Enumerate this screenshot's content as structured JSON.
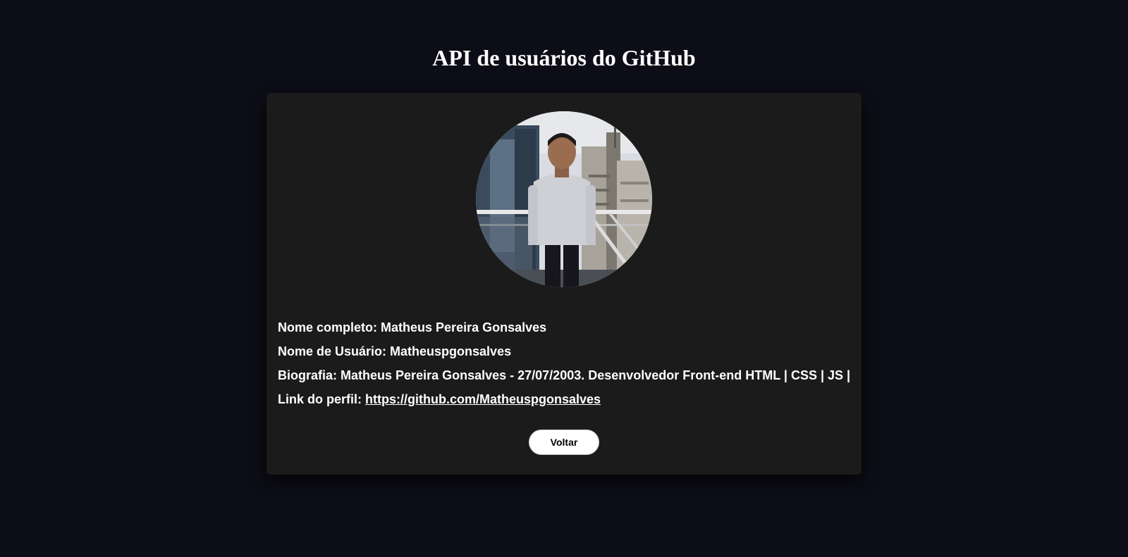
{
  "header": {
    "title": "API de usuários do GitHub"
  },
  "profile": {
    "avatar_icon": "profile-photo",
    "full_name_label": "Nome completo:",
    "full_name": "Matheus Pereira Gonsalves",
    "username_label": "Nome de Usuário:",
    "username": "Matheuspgonsalves",
    "bio_label": "Biografia:",
    "bio": "Matheus Pereira Gonsalves - 27/07/2003. Desenvolvedor Front-end HTML | CSS | JS |",
    "link_label": "Link do perfil:",
    "link": "https://github.com/Matheuspgonsalves"
  },
  "actions": {
    "back_label": "Voltar"
  },
  "colors": {
    "background": "#0d0d17",
    "card": "#1b1b1b",
    "text": "#ffffff",
    "button_bg": "#ffffff",
    "button_text": "#000000"
  }
}
